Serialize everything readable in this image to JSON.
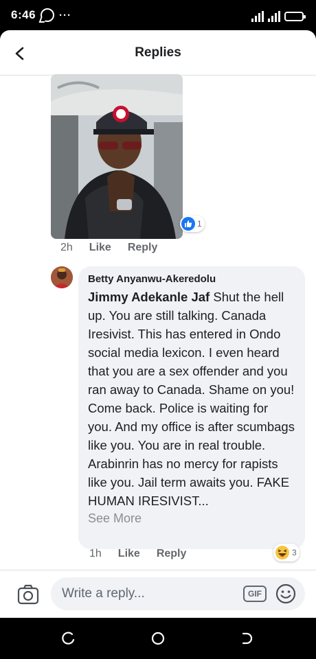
{
  "status_bar": {
    "time": "6:46",
    "overflow_dots": "···"
  },
  "header": {
    "title": "Replies"
  },
  "photo_comment": {
    "reaction_count": "1",
    "time": "2h",
    "like_label": "Like",
    "reply_label": "Reply"
  },
  "comment": {
    "author": "Betty Anyanwu-Akeredolu",
    "mention": "Jimmy Adekanle Jaf",
    "text": " Shut the hell up. You are still talking. Canada Iresivist. This has entered in Ondo social media lexicon. I even heard that you are a sex offender and you ran away to Canada. Shame on you! Come back. Police is waiting for you. And my office is after scumbags like you. You are in real trouble. Arabinrin has no mercy for rapists like you. Jail term awaits you. FAKE HUMAN IRESIVIST...",
    "see_more": "See More",
    "time": "1h",
    "like_label": "Like",
    "reply_label": "Reply",
    "reaction_count": "3"
  },
  "composer": {
    "placeholder": "Write a reply...",
    "gif_label": "GIF"
  },
  "colors": {
    "facebook_blue": "#1877f2",
    "bubble_gray": "#f0f2f5",
    "meta_gray": "#65676b"
  },
  "icons": {
    "back": "back-arrow-icon",
    "like": "like-icon",
    "haha": "haha-emoji-icon",
    "camera": "camera-icon",
    "emoji": "emoji-icon"
  }
}
